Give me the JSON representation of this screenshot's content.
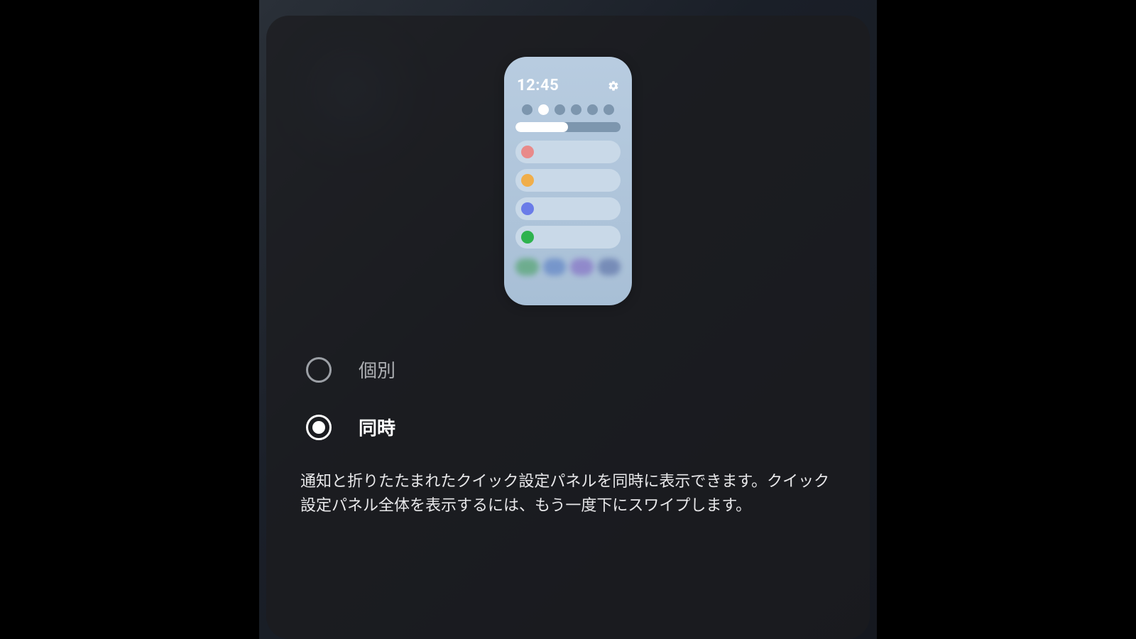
{
  "preview": {
    "time": "12:45"
  },
  "options": [
    {
      "label": "個別",
      "selected": false
    },
    {
      "label": "同時",
      "selected": true
    }
  ],
  "description": "通知と折りたたまれたクイック設定パネルを同時に表示できます。クイック設定パネル全体を表示するには、もう一度下にスワイプします。"
}
